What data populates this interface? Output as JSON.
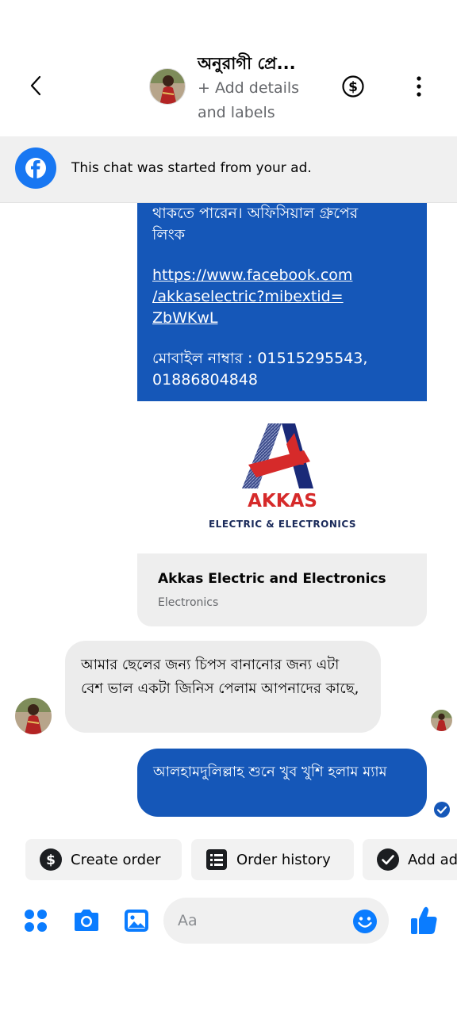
{
  "header": {
    "contact_name": "অনুরাগী প্রে...",
    "add_details": "+ Add details and labels"
  },
  "ad_banner": {
    "text": "This chat was started from your ad."
  },
  "messages": {
    "ad_message_lines": {
      "line1": "থাকতে পারেন। অফিসিয়াল গ্রুপের",
      "line2": "লিংক",
      "link_line1": "https://www.facebook.com",
      "link_line2": "/akkaselectric?mibextid=",
      "link_line3": "ZbWKwL",
      "mobile_line1": "মোবাইল নাম্বার : 01515295543,",
      "mobile_line2": "01886804848"
    },
    "logo": {
      "brand": "AKKAS",
      "tagline": "ELECTRIC & ELECTRONICS"
    },
    "page_card": {
      "title": "Akkas Electric and Electronics",
      "category": "Electronics"
    },
    "incoming": {
      "text": "আমার ছেলের জন্য চিপস বানানোর জন্য এটা বেশ ভাল একটা জিনিস পেলাম আপনাদের কাছে,"
    },
    "outgoing": {
      "text": "আলহামদুলিল্লাহ শুনে খুব খুশি হলাম ম্যাম"
    }
  },
  "quick_actions": [
    {
      "label": "Create order",
      "icon": "dollar-circle-icon"
    },
    {
      "label": "Order history",
      "icon": "receipt-icon"
    },
    {
      "label": "Add ad",
      "icon": "check-circle-icon"
    }
  ],
  "composer": {
    "placeholder": "Aa"
  },
  "colors": {
    "messenger_blue": "#1557b8",
    "facebook_blue": "#1877f2",
    "accent_blue": "#0a7cff"
  }
}
